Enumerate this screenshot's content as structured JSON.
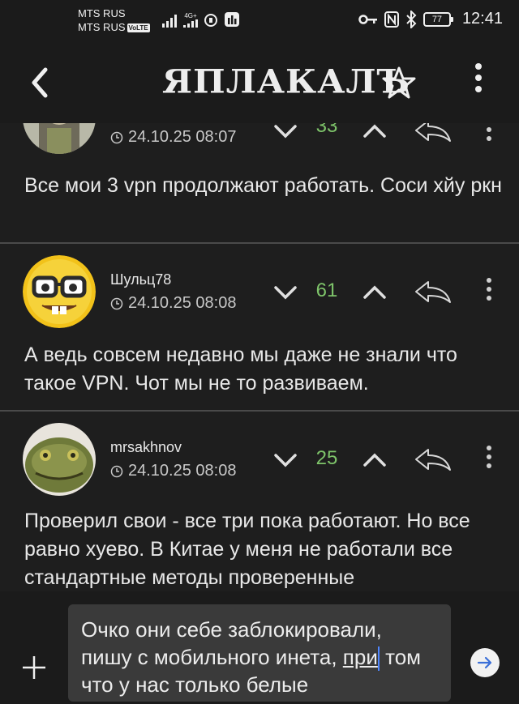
{
  "statusbar": {
    "carrier1": "MTS RUS",
    "carrier2": "MTS RUS",
    "volte": "VoLTE",
    "lte": "4G+",
    "battery": "77",
    "time": "12:41"
  },
  "header": {
    "logo": "ЯПЛАКАЛЪ",
    "icons": [
      "back-arrow",
      "star",
      "more-vertical"
    ]
  },
  "comments": [
    {
      "author": "",
      "date": "24.10.25 08:07",
      "score": "33",
      "text": "Все мои 3 vpn продолжают работать. Соси хйу ркн"
    },
    {
      "author": "Шульц78",
      "date": "24.10.25 08:08",
      "score": "61",
      "text": "А ведь совсем недавно мы даже не знали что такое VPN. Чот мы не то развиваем."
    },
    {
      "author": "mrsakhnov",
      "date": "24.10.25 08:08",
      "score": "25",
      "text": "Проверил свои - все три пока работают. Но все равно хуево. В Китае у меня не работали все стандартные методы проверенные"
    }
  ],
  "composer": {
    "text_before": "Очко они себе заблокировали, пишу с мобильного инета, ",
    "text_underlined": "при",
    "text_after": " том что у нас только белые"
  },
  "colors": {
    "background": "#1e1e1e",
    "score_green": "#7ec46a",
    "caret_blue": "#4f86ff"
  }
}
